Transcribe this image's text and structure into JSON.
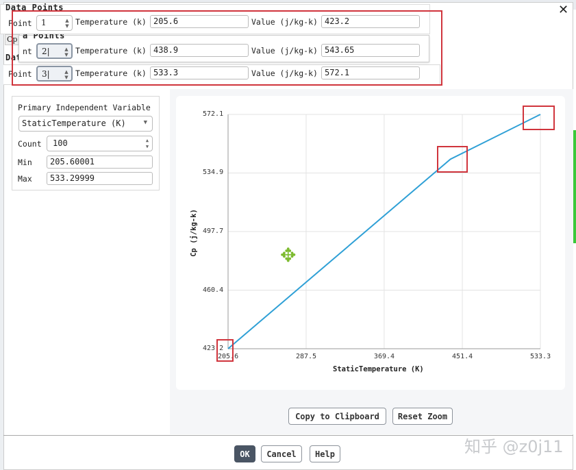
{
  "close_icon": "close-icon",
  "data_points": [
    {
      "title": "Data Points",
      "point_label": "Point",
      "point": "1",
      "temp_label": "Temperature (k)",
      "temp": "205.6",
      "value_label": "Value (j/kg-k)",
      "value": "423.2"
    },
    {
      "title": "a Points",
      "point_label": "nt",
      "point": "2",
      "temp_label": "Temperature (k)",
      "temp": "438.9",
      "value_label": "Value (j/kg-k)",
      "value": "543.65"
    },
    {
      "title": "Dat",
      "point_label": "Point",
      "point": "3",
      "temp_label": "Temperature (k)",
      "temp": "533.3",
      "value_label": "Value (j/kg-k)",
      "value": "572.1"
    }
  ],
  "partial_tab": "Cp",
  "options": {
    "heading": "Primary Independent Variable",
    "variable": "StaticTemperature (K)",
    "count_label": "Count",
    "count": "100",
    "min_label": "Min",
    "min": "205.60001",
    "max_label": "Max",
    "max": "533.29999"
  },
  "chart_data": {
    "type": "line",
    "xlabel": "StaticTemperature (K)",
    "ylabel": "Cp (j/kg-k)",
    "x": [
      205.6,
      438.9,
      533.3
    ],
    "y": [
      423.2,
      543.65,
      572.1
    ],
    "xticks": [
      "205.6",
      "287.5",
      "369.4",
      "451.4",
      "533.3"
    ],
    "yticks": [
      "423.2",
      "460.4",
      "497.7",
      "534.9",
      "572.1"
    ],
    "xlim": [
      205.6,
      533.3
    ],
    "ylim": [
      423.2,
      572.1
    ],
    "grid": true,
    "color": "#2fa0d6"
  },
  "chart_buttons": {
    "copy": "Copy to Clipboard",
    "reset": "Reset Zoom"
  },
  "footer": {
    "ok": "OK",
    "cancel": "Cancel",
    "help": "Help"
  },
  "watermark": "知乎 @z0j11"
}
